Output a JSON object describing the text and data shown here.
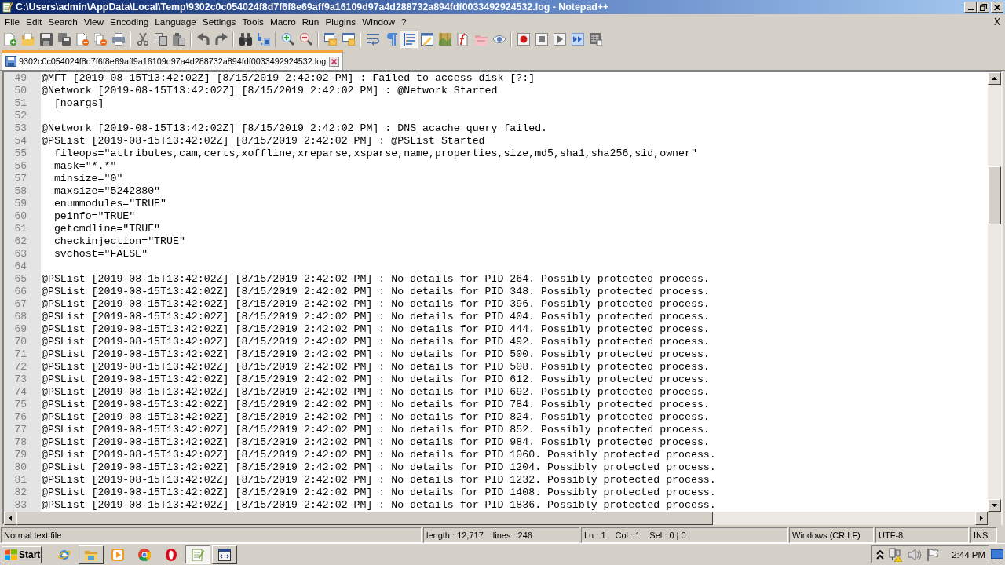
{
  "window": {
    "title": "C:\\Users\\admin\\AppData\\Local\\Temp\\9302c0c054024f8d7f6f8e69aff9a16109d97a4d288732a894fdf0033492924532.log - Notepad++"
  },
  "menu_bar": {
    "items": [
      "File",
      "Edit",
      "Search",
      "View",
      "Encoding",
      "Language",
      "Settings",
      "Tools",
      "Macro",
      "Run",
      "Plugins",
      "Window",
      "?"
    ],
    "close_document": "X"
  },
  "toolbar": {
    "groups": [
      [
        {
          "kind": "new",
          "pressed": false
        },
        {
          "kind": "open",
          "pressed": false
        },
        {
          "kind": "save",
          "pressed": false
        },
        {
          "kind": "saveall",
          "pressed": false
        },
        {
          "kind": "close",
          "pressed": false
        },
        {
          "kind": "closeall",
          "pressed": false
        },
        {
          "kind": "print",
          "pressed": false
        }
      ],
      [
        {
          "kind": "cut",
          "pressed": false
        },
        {
          "kind": "copy",
          "pressed": false
        },
        {
          "kind": "paste",
          "pressed": false
        }
      ],
      [
        {
          "kind": "undo",
          "pressed": false
        },
        {
          "kind": "redo",
          "pressed": false
        }
      ],
      [
        {
          "kind": "find",
          "pressed": false
        },
        {
          "kind": "replace",
          "pressed": false
        }
      ],
      [
        {
          "kind": "zoomin",
          "pressed": false
        },
        {
          "kind": "zoomout",
          "pressed": false
        }
      ],
      [
        {
          "kind": "syncv",
          "pressed": false
        },
        {
          "kind": "synch",
          "pressed": false
        }
      ],
      [
        {
          "kind": "wrap",
          "pressed": false
        },
        {
          "kind": "allchars",
          "pressed": false
        },
        {
          "kind": "indent",
          "pressed": true
        },
        {
          "kind": "udl",
          "pressed": false
        },
        {
          "kind": "docmap",
          "pressed": false
        },
        {
          "kind": "funclist",
          "pressed": false
        },
        {
          "kind": "folderws",
          "pressed": false
        },
        {
          "kind": "monitor",
          "pressed": false
        }
      ],
      [
        {
          "kind": "record",
          "pressed": false
        },
        {
          "kind": "stop",
          "pressed": false
        },
        {
          "kind": "play",
          "pressed": false
        },
        {
          "kind": "playmulti",
          "pressed": false
        },
        {
          "kind": "savemacro",
          "pressed": false
        }
      ]
    ]
  },
  "tabs": [
    {
      "label": "9302c0c054024f8d7f6f8e69aff9a16109d97a4d288732a894fdf0033492924532.log",
      "selected": true
    }
  ],
  "editor": {
    "lines": [
      {
        "number": "49",
        "text": "@MFT [2019-08-15T13:42:02Z] [8/15/2019 2:42:02 PM] : Failed to access disk [?:]"
      },
      {
        "number": "50",
        "text": "@Network [2019-08-15T13:42:02Z] [8/15/2019 2:42:02 PM] : @Network Started"
      },
      {
        "number": "51",
        "text": "  [noargs]"
      },
      {
        "number": "52"
      },
      {
        "number": "53",
        "text": "@Network [2019-08-15T13:42:02Z] [8/15/2019 2:42:02 PM] : DNS acache query failed."
      },
      {
        "number": "54",
        "text": "@PSList [2019-08-15T13:42:02Z] [8/15/2019 2:42:02 PM] : @PSList Started"
      },
      {
        "number": "55",
        "text": "  fileops=\"attributes,cam,certs,xoffline,xreparse,xsparse,name,properties,size,md5,sha1,sha256,sid,owner\""
      },
      {
        "number": "56",
        "text": "  mask=\"*.*\""
      },
      {
        "number": "57",
        "text": "  minsize=\"0\""
      },
      {
        "number": "58",
        "text": "  maxsize=\"5242880\""
      },
      {
        "number": "59",
        "text": "  enummodules=\"TRUE\""
      },
      {
        "number": "60",
        "text": "  peinfo=\"TRUE\""
      },
      {
        "number": "61",
        "text": "  getcmdline=\"TRUE\""
      },
      {
        "number": "62",
        "text": "  checkinjection=\"TRUE\""
      },
      {
        "number": "63",
        "text": "  svchost=\"FALSE\""
      },
      {
        "number": "64"
      },
      {
        "number": "65",
        "text": "@PSList [2019-08-15T13:42:02Z] [8/15/2019 2:42:02 PM] : No details for PID 264. Possibly protected process."
      },
      {
        "number": "66",
        "text": "@PSList [2019-08-15T13:42:02Z] [8/15/2019 2:42:02 PM] : No details for PID 348. Possibly protected process."
      },
      {
        "number": "67",
        "text": "@PSList [2019-08-15T13:42:02Z] [8/15/2019 2:42:02 PM] : No details for PID 396. Possibly protected process."
      },
      {
        "number": "68",
        "text": "@PSList [2019-08-15T13:42:02Z] [8/15/2019 2:42:02 PM] : No details for PID 404. Possibly protected process."
      },
      {
        "number": "69",
        "text": "@PSList [2019-08-15T13:42:02Z] [8/15/2019 2:42:02 PM] : No details for PID 444. Possibly protected process."
      },
      {
        "number": "70",
        "text": "@PSList [2019-08-15T13:42:02Z] [8/15/2019 2:42:02 PM] : No details for PID 492. Possibly protected process."
      },
      {
        "number": "71",
        "text": "@PSList [2019-08-15T13:42:02Z] [8/15/2019 2:42:02 PM] : No details for PID 500. Possibly protected process."
      },
      {
        "number": "72",
        "text": "@PSList [2019-08-15T13:42:02Z] [8/15/2019 2:42:02 PM] : No details for PID 508. Possibly protected process."
      },
      {
        "number": "73",
        "text": "@PSList [2019-08-15T13:42:02Z] [8/15/2019 2:42:02 PM] : No details for PID 612. Possibly protected process."
      },
      {
        "number": "74",
        "text": "@PSList [2019-08-15T13:42:02Z] [8/15/2019 2:42:02 PM] : No details for PID 692. Possibly protected process."
      },
      {
        "number": "75",
        "text": "@PSList [2019-08-15T13:42:02Z] [8/15/2019 2:42:02 PM] : No details for PID 784. Possibly protected process."
      },
      {
        "number": "76",
        "text": "@PSList [2019-08-15T13:42:02Z] [8/15/2019 2:42:02 PM] : No details for PID 824. Possibly protected process."
      },
      {
        "number": "77",
        "text": "@PSList [2019-08-15T13:42:02Z] [8/15/2019 2:42:02 PM] : No details for PID 852. Possibly protected process."
      },
      {
        "number": "78",
        "text": "@PSList [2019-08-15T13:42:02Z] [8/15/2019 2:42:02 PM] : No details for PID 984. Possibly protected process."
      },
      {
        "number": "79",
        "text": "@PSList [2019-08-15T13:42:02Z] [8/15/2019 2:42:02 PM] : No details for PID 1060. Possibly protected process."
      },
      {
        "number": "80",
        "text": "@PSList [2019-08-15T13:42:02Z] [8/15/2019 2:42:02 PM] : No details for PID 1204. Possibly protected process."
      },
      {
        "number": "81",
        "text": "@PSList [2019-08-15T13:42:02Z] [8/15/2019 2:42:02 PM] : No details for PID 1232. Possibly protected process."
      },
      {
        "number": "82",
        "text": "@PSList [2019-08-15T13:42:02Z] [8/15/2019 2:42:02 PM] : No details for PID 1408. Possibly protected process."
      },
      {
        "number": "83",
        "text": "@PSList [2019-08-15T13:42:02Z] [8/15/2019 2:42:02 PM] : No details for PID 1836. Possibly protected process."
      }
    ]
  },
  "status_bar": {
    "panels": [
      {
        "texts": [
          "Normal text file"
        ]
      },
      {
        "texts": [
          "length : 12,717",
          "lines : 246"
        ]
      },
      {
        "texts": [
          "Ln : 1",
          "Col : 1",
          "Sel : 0 | 0"
        ]
      },
      {
        "texts": [
          "Windows (CR LF)"
        ]
      },
      {
        "texts": [
          "UTF-8"
        ]
      },
      {
        "texts": [
          "INS"
        ]
      }
    ]
  },
  "taskbar": {
    "start": "Start",
    "apps": [
      {
        "kind": "ie",
        "running": false,
        "selected": false
      },
      {
        "kind": "explorer",
        "running": true,
        "selected": false
      },
      {
        "kind": "media",
        "running": false,
        "selected": false
      },
      {
        "kind": "chrome",
        "running": false,
        "selected": false
      },
      {
        "kind": "opera",
        "running": false,
        "selected": false
      },
      {
        "kind": "notepad",
        "running": true,
        "selected": true
      },
      {
        "kind": "viewer",
        "running": true,
        "selected": false
      }
    ],
    "tray": [
      {
        "kind": "chevron"
      },
      {
        "kind": "network"
      },
      {
        "kind": "speaker"
      },
      {
        "kind": "flag"
      }
    ],
    "clock": "2:44 PM"
  }
}
